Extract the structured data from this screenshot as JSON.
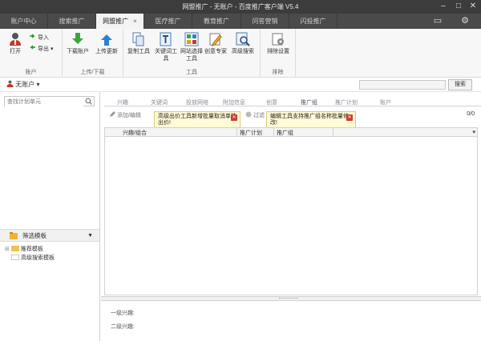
{
  "window": {
    "title": "网盟推广 - 无账户 - 百度推广客户端 V5.4"
  },
  "tabs": [
    {
      "label": "账户中心",
      "active": false
    },
    {
      "label": "搜索推广",
      "active": false
    },
    {
      "label": "网盟推广",
      "active": true,
      "close": "×"
    },
    {
      "label": "医疗推广",
      "active": false
    },
    {
      "label": "教育推广",
      "active": false
    },
    {
      "label": "问答营销",
      "active": false
    },
    {
      "label": "闪投推广",
      "active": false
    }
  ],
  "ribbon": {
    "account": {
      "label": "账户",
      "open": "打开",
      "import": "导入",
      "export": "导出"
    },
    "updown": {
      "label": "上传/下载",
      "download": "下载账户",
      "upload": "上传更新"
    },
    "tools": {
      "label": "工具",
      "copy": "复制工具",
      "keyword": "关键词工具",
      "site": "网站选择工具",
      "creative": "创意专家",
      "advsearch": "高级搜索"
    },
    "sort": {
      "label": "排除",
      "settings": "排除设置"
    }
  },
  "acct": {
    "name": "无账户",
    "search_button": "搜索"
  },
  "left": {
    "search_placeholder": "查找计划单元",
    "filter_title": "筛选模板",
    "tree": [
      "推荐模板",
      "高级搜索模板"
    ]
  },
  "subtabs": [
    "兴趣",
    "关键词",
    "投放网络",
    "附加信息",
    "创意",
    "推广组",
    "推广计划",
    "账户"
  ],
  "toolbar": {
    "add_edit": "添加/编辑",
    "filter": "过滤",
    "count": "0/0"
  },
  "tips": {
    "tip1": "高级出价工具新增批量取消单独出价!",
    "tip2": "编辑工具支持推广组名称批量修改!"
  },
  "grid": {
    "columns": [
      "兴趣/组合",
      "推广计划",
      "推广组"
    ]
  },
  "bottom": {
    "level1": "一级兴趣:",
    "level2": "二级兴趣:"
  },
  "colors": {
    "titlebar": "#3c3c3c",
    "tab_active": "#f3f3f3",
    "tip_bg": "#fffbd6",
    "close_red": "#d43a2f"
  }
}
